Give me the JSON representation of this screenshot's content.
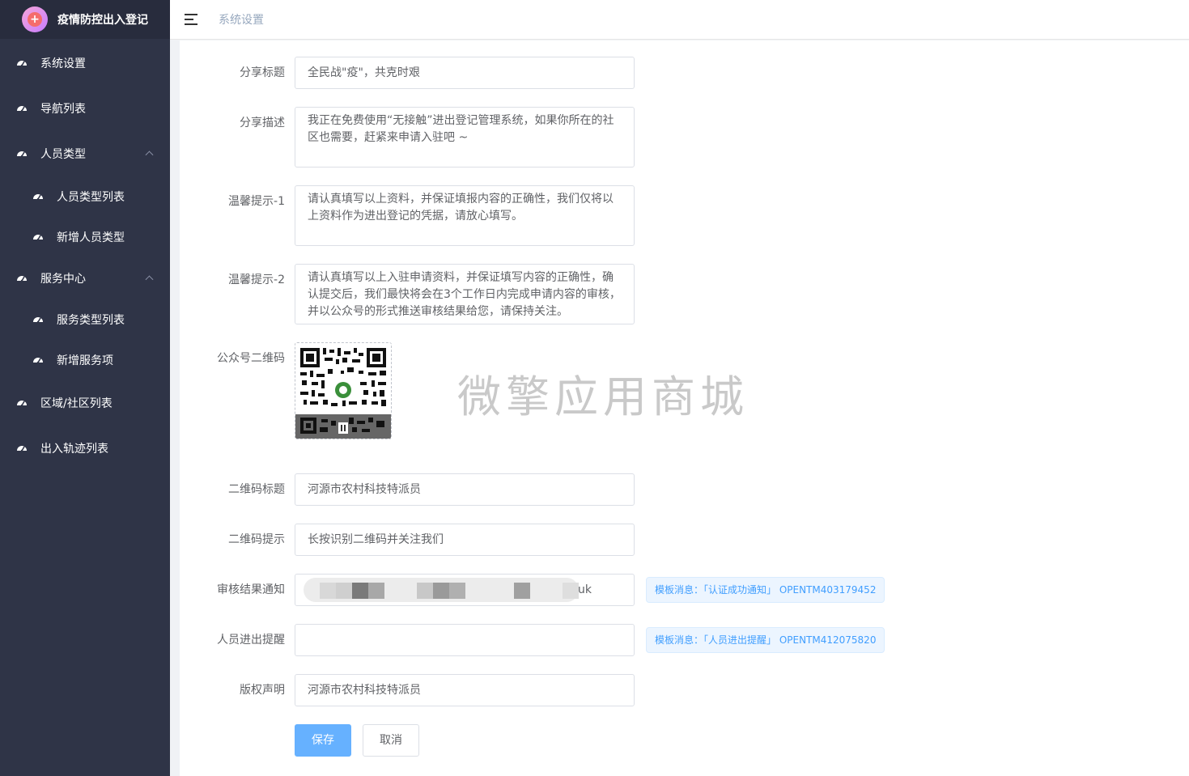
{
  "brand": {
    "title": "疫情防控出入登记",
    "logo_glyph": "+"
  },
  "header": {
    "breadcrumb": "系统设置"
  },
  "sidebar": {
    "items": [
      {
        "label": "系统设置",
        "icon": "dashboard-icon"
      },
      {
        "label": "导航列表",
        "icon": "dashboard-icon"
      },
      {
        "label": "人员类型",
        "icon": "dashboard-icon",
        "expanded": true
      },
      {
        "label": "人员类型列表",
        "icon": "dashboard-icon"
      },
      {
        "label": "新增人员类型",
        "icon": "dashboard-icon"
      },
      {
        "label": "服务中心",
        "icon": "dashboard-icon",
        "expanded": true
      },
      {
        "label": "服务类型列表",
        "icon": "dashboard-icon"
      },
      {
        "label": "新增服务项",
        "icon": "dashboard-icon"
      },
      {
        "label": "区域/社区列表",
        "icon": "dashboard-icon"
      },
      {
        "label": "出入轨迹列表",
        "icon": "dashboard-icon"
      }
    ]
  },
  "form": {
    "share_title": {
      "label": "分享标题",
      "value": "全民战\"疫\"，共克时艰"
    },
    "share_desc": {
      "label": "分享描述",
      "value": "我正在免费使用“无接触”进出登记管理系统，如果你所在的社区也需要，赶紧来申请入驻吧 ~"
    },
    "tip1": {
      "label": "温馨提示-1",
      "value": "请认真填写以上资料，并保证填报内容的正确性，我们仅将以上资料作为进出登记的凭据，请放心填写。"
    },
    "tip2": {
      "label": "温馨提示-2",
      "value": "请认真填写以上入驻申请资料，并保证填写内容的正确性，确认提交后，我们最快将会在3个工作日内完成申请内容的审核，并以公众号的形式推送审核结果给您，请保持关注。"
    },
    "qrcode": {
      "label": "公众号二维码"
    },
    "qr_title": {
      "label": "二维码标题",
      "value": "河源市农村科技特派员"
    },
    "qr_tip": {
      "label": "二维码提示",
      "value": "长按识别二维码并关注我们"
    },
    "audit_notify": {
      "label": "审核结果通知",
      "value": "uk",
      "tag": "模板消息：「认证成功通知」 OPENTM403179452"
    },
    "entry_notify": {
      "label": "人员进出提醒",
      "value": "",
      "tag": "模板消息：「人员进出提醒」 OPENTM412075820"
    },
    "copyright": {
      "label": "版权声明",
      "value": "河源市农村科技特派员"
    }
  },
  "buttons": {
    "save": "保存",
    "cancel": "取消"
  },
  "watermark": "微擎应用商城",
  "colors": {
    "sidebar_bg": "#2f3447",
    "primary": "#66b1ff",
    "tag_text": "#409eff"
  }
}
